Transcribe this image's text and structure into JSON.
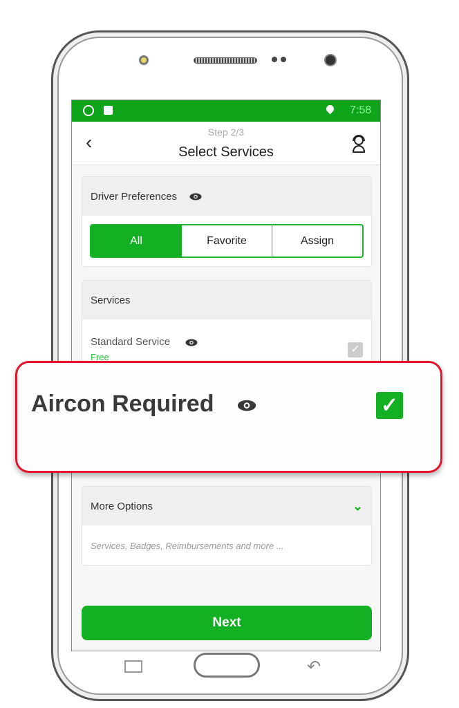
{
  "status_bar": {
    "time": "7:58",
    "icons": [
      "whatsapp-icon",
      "app-icon",
      "location-pin-icon"
    ]
  },
  "header": {
    "step": "Step 2/3",
    "title": "Select Services"
  },
  "driver_preferences": {
    "title": "Driver Preferences",
    "options": [
      "All",
      "Favorite",
      "Assign"
    ],
    "selected": "All"
  },
  "services": {
    "title": "Services",
    "items": [
      {
        "name": "Standard Service",
        "price": "Free",
        "checked": true,
        "disabled": true
      }
    ]
  },
  "callout": {
    "label": "Aircon Required",
    "checked": true
  },
  "more_options": {
    "title": "More Options",
    "subtitle": "Services, Badges, Reimbursements and more ..."
  },
  "next_label": "Next",
  "colors": {
    "accent": "#14b023",
    "status_bar": "#0ea51b",
    "callout_border": "#e3142b"
  }
}
